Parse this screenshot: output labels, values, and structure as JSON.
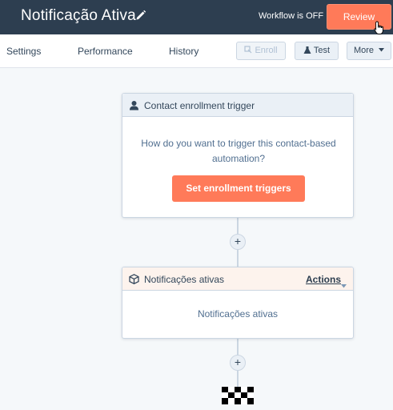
{
  "header": {
    "title": "Notificação Ativa",
    "status": "Workflow is OFF",
    "review_label": "Review"
  },
  "toolbar": {
    "tabs": [
      {
        "label": "Settings"
      },
      {
        "label": "Performance"
      },
      {
        "label": "History"
      }
    ],
    "enroll_label": "Enroll",
    "test_label": "Test",
    "more_label": "More"
  },
  "trigger_card": {
    "header_label": "Contact enrollment trigger",
    "question": "How do you want to trigger this contact-based automation?",
    "button_label": "Set enrollment triggers"
  },
  "action_card": {
    "header_label": "Notificações ativas",
    "actions_label": "Actions",
    "body_text": "Notificações ativas"
  },
  "plus_symbol": "+",
  "colors": {
    "header_bg": "#2d3e50",
    "accent": "#ff7a59",
    "canvas_bg": "#f5f8fa",
    "trigger_head_bg": "#eaf0f6",
    "action_head_bg": "#fdf3ed"
  },
  "icons": [
    "pencil-icon",
    "pointer-cursor-icon",
    "enroll-icon",
    "flask-icon",
    "caret-down-icon",
    "contact-icon",
    "cube-icon",
    "checkered-flag-icon"
  ]
}
